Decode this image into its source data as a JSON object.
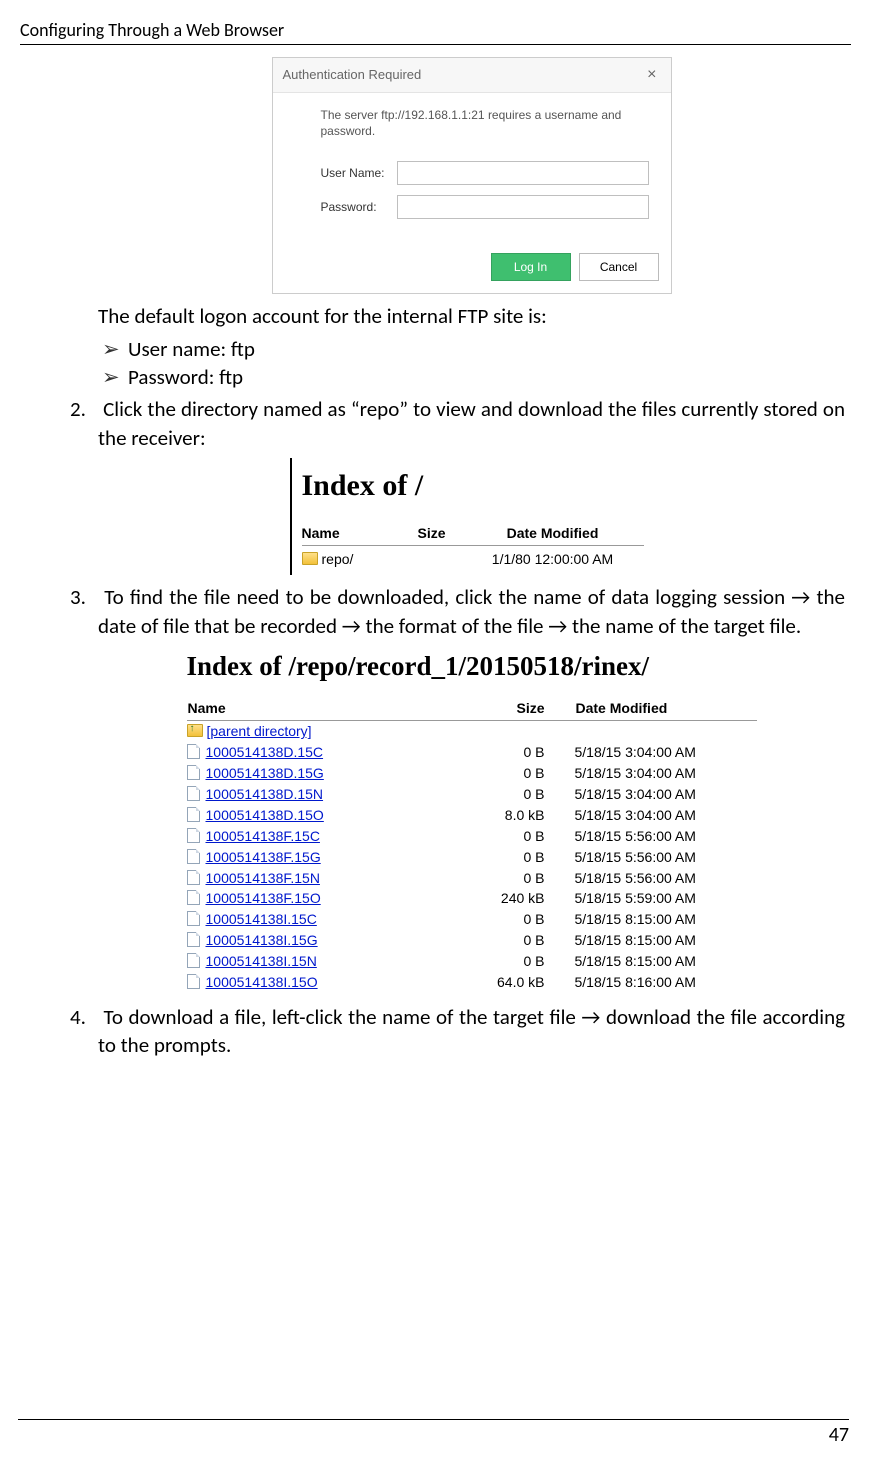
{
  "header": "Configuring Through a Web Browser",
  "page_number": "47",
  "auth_dialog": {
    "title": "Authentication Required",
    "message": "The server ftp://192.168.1.1:21 requires a username and password.",
    "username_label": "User Name:",
    "password_label": "Password:",
    "login_btn": "Log In",
    "cancel_btn": "Cancel"
  },
  "para_default": "The default logon account for the internal FTP site is:",
  "bullets": {
    "user": "User name: ftp",
    "pass": "Password: ftp"
  },
  "step2": "Click the directory named as “repo” to view and download the files currently stored on the receiver:",
  "index_small": {
    "title": "Index of /",
    "name_h": "Name",
    "size_h": "Size",
    "date_h": "Date Modified",
    "row_name": "repo/",
    "row_date": "1/1/80 12:00:00 AM"
  },
  "step3": "To find the file need to be downloaded, click the name of data logging session → the date of file that be recorded → the format of the file → the name of the target file.",
  "index_large": {
    "title": "Index of /repo/record_1/20150518/rinex/",
    "name_h": "Name",
    "size_h": "Size",
    "date_h": "Date Modified",
    "parent": "[parent directory]",
    "rows": [
      {
        "name": "1000514138D.15C",
        "size": "0 B",
        "date": "5/18/15 3:04:00 AM"
      },
      {
        "name": "1000514138D.15G",
        "size": "0 B",
        "date": "5/18/15 3:04:00 AM"
      },
      {
        "name": "1000514138D.15N",
        "size": "0 B",
        "date": "5/18/15 3:04:00 AM"
      },
      {
        "name": "1000514138D.15O",
        "size": "8.0 kB",
        "date": "5/18/15 3:04:00 AM"
      },
      {
        "name": "1000514138F.15C",
        "size": "0 B",
        "date": "5/18/15 5:56:00 AM"
      },
      {
        "name": "1000514138F.15G",
        "size": "0 B",
        "date": "5/18/15 5:56:00 AM"
      },
      {
        "name": "1000514138F.15N",
        "size": "0 B",
        "date": "5/18/15 5:56:00 AM"
      },
      {
        "name": "1000514138F.15O",
        "size": "240 kB",
        "date": "5/18/15 5:59:00 AM"
      },
      {
        "name": "1000514138I.15C",
        "size": "0 B",
        "date": "5/18/15 8:15:00 AM"
      },
      {
        "name": "1000514138I.15G",
        "size": "0 B",
        "date": "5/18/15 8:15:00 AM"
      },
      {
        "name": "1000514138I.15N",
        "size": "0 B",
        "date": "5/18/15 8:15:00 AM"
      },
      {
        "name": "1000514138I.15O",
        "size": "64.0 kB",
        "date": "5/18/15 8:16:00 AM"
      }
    ]
  },
  "step4": "To download a file, left-click the name of the target file → download the file according to the prompts."
}
